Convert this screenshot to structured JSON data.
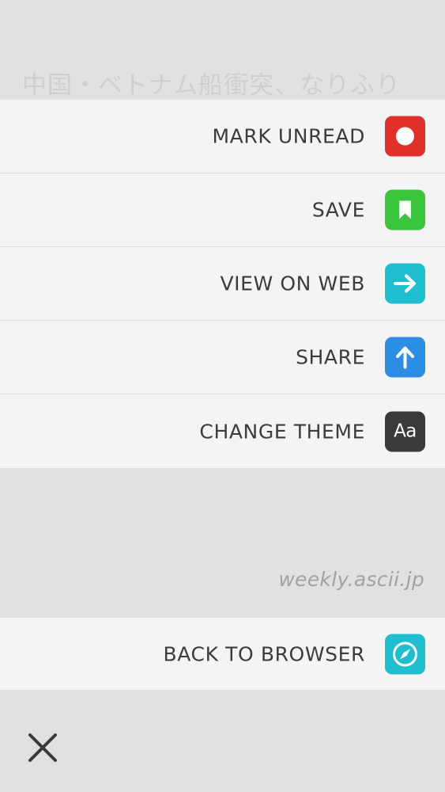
{
  "background": {
    "article_title": "中国・ベトナム船衝突、なりふり",
    "source_domain": "weekly.ascii.jp"
  },
  "menu": {
    "items": [
      {
        "label": "MARK UNREAD",
        "icon": "circle-icon",
        "color": "#e0302a"
      },
      {
        "label": "SAVE",
        "icon": "bookmark-icon",
        "color": "#39c63c"
      },
      {
        "label": "VIEW ON WEB",
        "icon": "arrow-right-icon",
        "color": "#1fbfcf"
      },
      {
        "label": "SHARE",
        "icon": "arrow-up-icon",
        "color": "#2b8de3"
      },
      {
        "label": "CHANGE THEME",
        "icon": "theme-aa-icon",
        "icon_text": "Aa",
        "color": "#3a3a3a"
      }
    ],
    "back_to_browser": {
      "label": "BACK TO BROWSER",
      "icon": "compass-icon",
      "color": "#1fbfcf"
    }
  },
  "close": {
    "icon": "close-icon"
  }
}
